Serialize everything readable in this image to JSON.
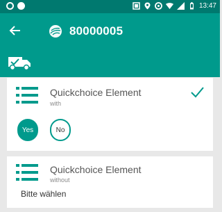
{
  "status_bar": {
    "time": "13:47",
    "icons": [
      "circle-icon",
      "circle-filled-icon",
      "screenshot-icon",
      "location-icon",
      "data-saver-icon",
      "wifi-icon",
      "signal-icon",
      "battery-icon"
    ]
  },
  "app_bar": {
    "back_icon": "arrow-left-icon",
    "brand_icon": "feather-logo-icon",
    "title": "80000005"
  },
  "sub_bar": {
    "icon": "truck-check-icon"
  },
  "cards": [
    {
      "icon": "list-icon",
      "title": "Quickchoice Element",
      "subtitle": "with",
      "status_icon": "check-icon",
      "options": [
        {
          "label": "Yes",
          "selected": true
        },
        {
          "label": "No",
          "selected": false
        }
      ]
    },
    {
      "icon": "list-icon",
      "title": "Quickchoice Element",
      "subtitle": "without",
      "value": "Bitte wählen"
    }
  ],
  "colors": {
    "status_bar": "#00796f",
    "primary": "#009a8c",
    "background": "#e8e8e8",
    "card": "#ffffff"
  }
}
